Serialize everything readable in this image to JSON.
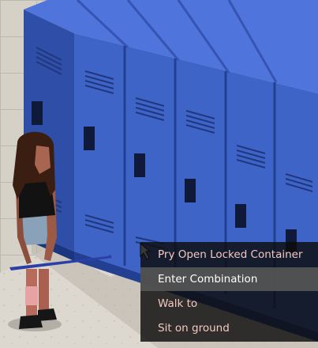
{
  "context_menu": {
    "items": [
      {
        "label": "Pry Open Locked Container",
        "highlighted": false
      },
      {
        "label": "Enter Combination",
        "highlighted": true
      },
      {
        "label": "Walk to",
        "highlighted": false
      },
      {
        "label": "Sit on ground",
        "highlighted": false
      }
    ]
  },
  "colors": {
    "locker_blue": "#3f64c8",
    "menu_text": "#f2c9c0",
    "menu_highlight": "#555555"
  }
}
